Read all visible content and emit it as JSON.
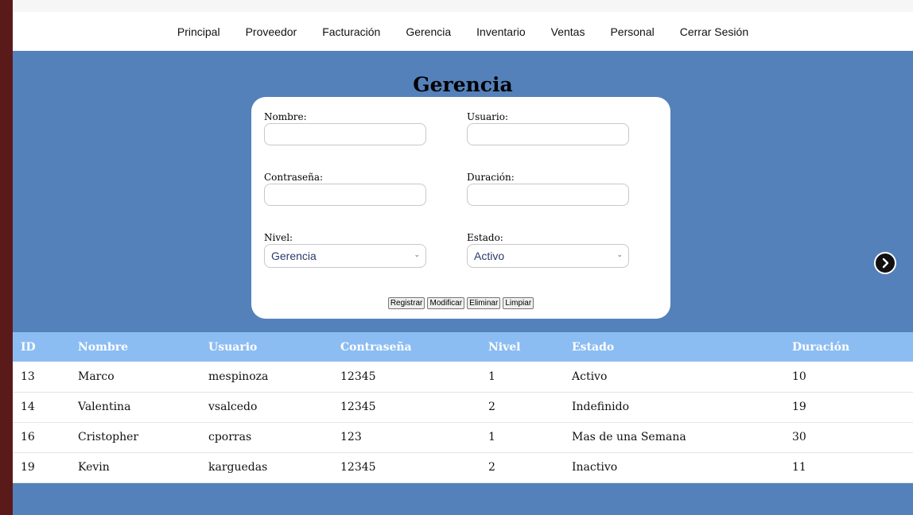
{
  "nav": {
    "items": [
      {
        "label": "Principal"
      },
      {
        "label": "Proveedor"
      },
      {
        "label": "Facturación"
      },
      {
        "label": "Gerencia"
      },
      {
        "label": "Inventario"
      },
      {
        "label": "Ventas"
      },
      {
        "label": "Personal"
      },
      {
        "label": "Cerrar Sesión"
      }
    ]
  },
  "page_title": "Gerencia",
  "form": {
    "nombre_label": "Nombre:",
    "nombre_value": "",
    "usuario_label": "Usuario:",
    "usuario_value": "",
    "contrasena_label": "Contraseña:",
    "contrasena_value": "",
    "duracion_label": "Duración:",
    "duracion_value": "",
    "nivel_label": "Nivel:",
    "nivel_selected": "Gerencia",
    "estado_label": "Estado:",
    "estado_selected": "Activo",
    "buttons": {
      "registrar": "Registrar",
      "modificar": "Modificar",
      "eliminar": "Eliminar",
      "limpiar": "Limpiar"
    }
  },
  "next_icon": "chevron-right-circle-icon",
  "table": {
    "headers": [
      "ID",
      "Nombre",
      "Usuario",
      "Contraseña",
      "Nivel",
      "Estado",
      "Duración"
    ],
    "rows": [
      [
        "13",
        "Marco",
        "mespinoza",
        "12345",
        "1",
        "Activo",
        "10"
      ],
      [
        "14",
        "Valentina",
        "vsalcedo",
        "12345",
        "2",
        "Indefinido",
        "19"
      ],
      [
        "16",
        "Cristopher",
        "cporras",
        "123",
        "1",
        "Mas de una Semana",
        "30"
      ],
      [
        "19",
        "Kevin",
        "karguedas",
        "12345",
        "2",
        "Inactivo",
        "11"
      ]
    ]
  }
}
